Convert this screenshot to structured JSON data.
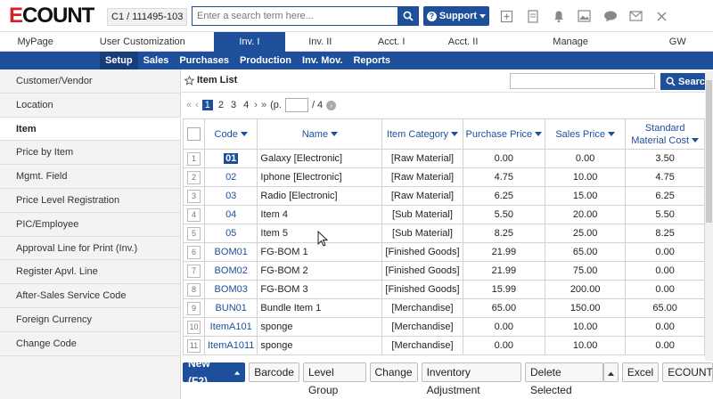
{
  "logo": {
    "text_e": "E",
    "text_rest": "COUNT"
  },
  "company_code": "C1 / 111495-103",
  "search": {
    "placeholder": "Enter a search term here..."
  },
  "support_label": "Support",
  "main_tabs": [
    "MyPage",
    "User Customization",
    "Inv. I",
    "Inv. II",
    "Acct. I",
    "Acct. II",
    "Manage",
    "GW"
  ],
  "sub_tabs": [
    "Setup",
    "Sales",
    "Purchases",
    "Production",
    "Inv. Mov.",
    "Reports"
  ],
  "sidebar": [
    "Customer/Vendor",
    "Location",
    "Item",
    "Price by Item",
    "Mgmt. Field",
    "Price Level Registration",
    "PIC/Employee",
    "Approval Line for Print (Inv.)",
    "Register Apvl. Line",
    "After-Sales Service Code",
    "Foreign Currency",
    "Change Code"
  ],
  "content": {
    "title": "Item List",
    "search_button": "Search",
    "pager": {
      "pages": [
        "1",
        "2",
        "3",
        "4"
      ],
      "page_prefix": "(p.",
      "page_suffix": "/ 4"
    }
  },
  "table": {
    "headers": {
      "code": "Code",
      "name": "Name",
      "category": "Item Category",
      "purchase": "Purchase Price",
      "sales": "Sales Price",
      "std1": "Standard",
      "std2": "Material Cost"
    },
    "rows": [
      {
        "n": "1",
        "code": "01",
        "name": "Galaxy [Electronic]",
        "cat": "[Raw Material]",
        "pp": "0.00",
        "sp": "0.00",
        "smc": "3.50"
      },
      {
        "n": "2",
        "code": "02",
        "name": "Iphone [Electronic]",
        "cat": "[Raw Material]",
        "pp": "4.75",
        "sp": "10.00",
        "smc": "4.75"
      },
      {
        "n": "3",
        "code": "03",
        "name": "Radio [Electronic]",
        "cat": "[Raw Material]",
        "pp": "6.25",
        "sp": "15.00",
        "smc": "6.25"
      },
      {
        "n": "4",
        "code": "04",
        "name": "Item 4",
        "cat": "[Sub Material]",
        "pp": "5.50",
        "sp": "20.00",
        "smc": "5.50"
      },
      {
        "n": "5",
        "code": "05",
        "name": "Item 5",
        "cat": "[Sub Material]",
        "pp": "8.25",
        "sp": "25.00",
        "smc": "8.25"
      },
      {
        "n": "6",
        "code": "BOM01",
        "name": "FG-BOM 1",
        "cat": "[Finished Goods]",
        "pp": "21.99",
        "sp": "65.00",
        "smc": "0.00"
      },
      {
        "n": "7",
        "code": "BOM02",
        "name": "FG-BOM 2",
        "cat": "[Finished Goods]",
        "pp": "21.99",
        "sp": "75.00",
        "smc": "0.00"
      },
      {
        "n": "8",
        "code": "BOM03",
        "name": "FG-BOM 3",
        "cat": "[Finished Goods]",
        "pp": "15.99",
        "sp": "200.00",
        "smc": "0.00"
      },
      {
        "n": "9",
        "code": "BUN01",
        "name": "Bundle Item 1",
        "cat": "[Merchandise]",
        "pp": "65.00",
        "sp": "150.00",
        "smc": "65.00"
      },
      {
        "n": "10",
        "code": "ItemA101",
        "name": "sponge",
        "cat": "[Merchandise]",
        "pp": "0.00",
        "sp": "10.00",
        "smc": "0.00"
      },
      {
        "n": "11",
        "code": "ItemA1011",
        "name": "sponge",
        "cat": "[Merchandise]",
        "pp": "0.00",
        "sp": "10.00",
        "smc": "0.00"
      }
    ]
  },
  "footer": {
    "new": "New (F2)",
    "barcode": "Barcode",
    "level_group": "Level Group",
    "change": "Change",
    "inventory_adjustment": "Inventory Adjustment",
    "delete_selected": "Delete Selected",
    "excel": "Excel",
    "ecount": "ECOUNT V"
  },
  "colors": {
    "brand_blue": "#1d4f9b",
    "logo_red": "#d62028"
  }
}
